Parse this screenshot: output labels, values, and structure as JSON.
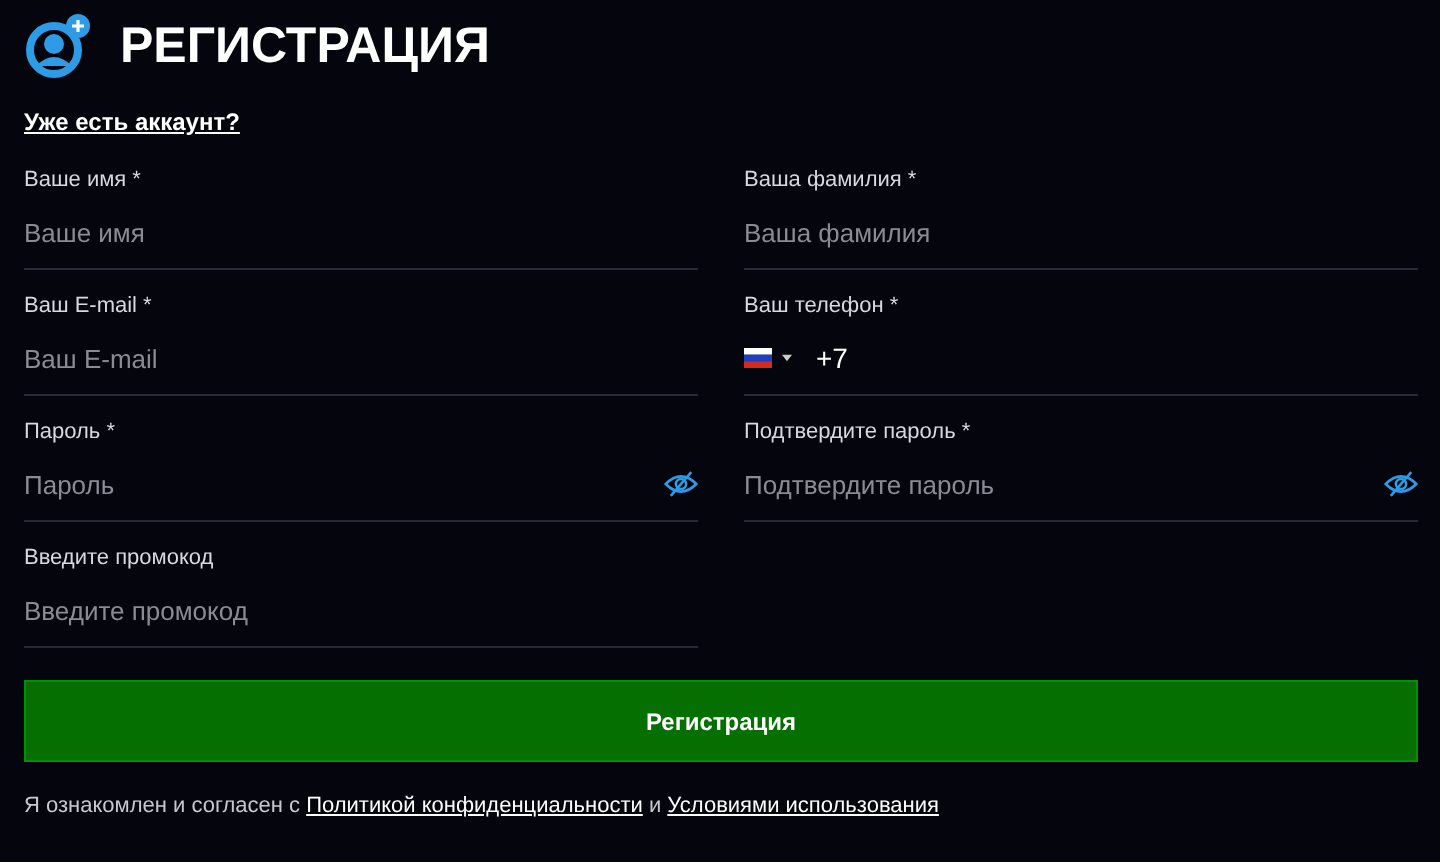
{
  "header": {
    "title": "РЕГИСТРАЦИЯ"
  },
  "login_link": "Уже есть аккаунт?",
  "fields": [
    {
      "kind": "text",
      "label": "Ваше имя *",
      "placeholder": "Ваше имя"
    },
    {
      "kind": "text",
      "label": "Ваша фамилия *",
      "placeholder": "Ваша фамилия"
    },
    {
      "kind": "text",
      "label": "Ваш E-mail *",
      "placeholder": "Ваш E-mail"
    },
    {
      "kind": "phone",
      "label": "Ваш телефон *",
      "value": "+7"
    },
    {
      "kind": "password",
      "label": "Пароль *",
      "placeholder": "Пароль"
    },
    {
      "kind": "password",
      "label": "Подтвердите пароль *",
      "placeholder": "Подтвердите пароль"
    },
    {
      "kind": "text",
      "label": "Введите промокод",
      "placeholder": "Введите промокод"
    }
  ],
  "submit": "Регистрация",
  "consent": {
    "text": "Я ознакомлен и согласен с",
    "privacy_link": "Политикой конфиденциальности",
    "joiner": "и",
    "terms_link": "Условиями использования"
  }
}
